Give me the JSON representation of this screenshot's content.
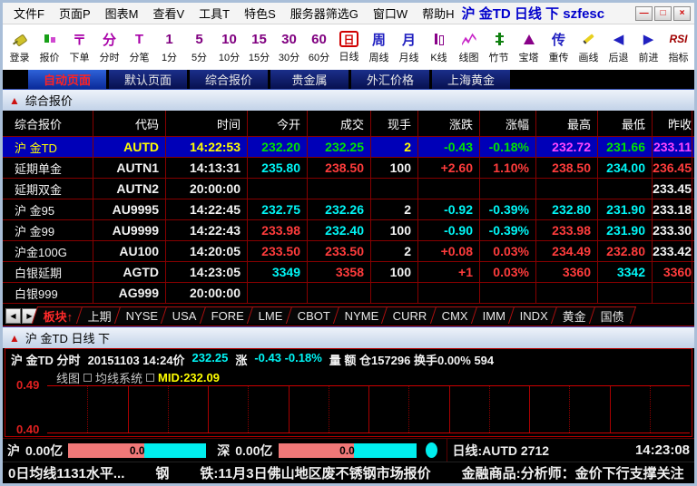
{
  "colors": {
    "up": "#ff3c3c",
    "down": "#00f6f6",
    "green": "#00e400",
    "magenta": "#ff46ff",
    "yellow": "#ffff00",
    "white": "#f2f2f2",
    "grid": "#860000",
    "sel_bg": "#0000b8",
    "title_blue": "#0000cc",
    "tab_active_red": "#ff2222",
    "bar_red": "#f07878",
    "bar_cyan": "#00eeee",
    "mid_yellow": "#ffff00"
  },
  "window": {
    "title": "沪 金TD 日线 下 szfesc",
    "controls": [
      {
        "name": "minimize-button",
        "glyph": "—"
      },
      {
        "name": "maximize-button",
        "glyph": "□"
      },
      {
        "name": "close-button",
        "glyph": "×"
      }
    ]
  },
  "menu": {
    "items": [
      {
        "name": "menu-file",
        "label": "文件F"
      },
      {
        "name": "menu-page",
        "label": "页面P"
      },
      {
        "name": "menu-chart",
        "label": "图表M"
      },
      {
        "name": "menu-view",
        "label": "查看V"
      },
      {
        "name": "menu-tools",
        "label": "工具T"
      },
      {
        "name": "menu-features",
        "label": "特色S"
      },
      {
        "name": "menu-server-filter",
        "label": "服务器筛选G"
      },
      {
        "name": "menu-window",
        "label": "窗口W"
      },
      {
        "name": "menu-help",
        "label": "帮助H"
      }
    ]
  },
  "toolbar": {
    "items": [
      {
        "name": "toolbar-login",
        "label": "登录",
        "icon": "login-plug-icon",
        "shape": "plug"
      },
      {
        "name": "toolbar-quote",
        "label": "报价",
        "icon": "quote-board-icon",
        "shape": "quote"
      },
      {
        "name": "toolbar-order",
        "label": "下单",
        "icon": "order-icon",
        "glyph": "〒",
        "color": "#a800a8"
      },
      {
        "name": "toolbar-intraday",
        "label": "分时",
        "icon": "intraday-chart-icon",
        "glyph": "分",
        "color": "#a800a8"
      },
      {
        "name": "toolbar-tick",
        "label": "分笔",
        "icon": "tick-chart-icon",
        "glyph": "T",
        "color": "#a800a8"
      },
      {
        "name": "toolbar-1min",
        "label": "1分",
        "icon": "1min-icon",
        "glyph": "1",
        "color": "#800080"
      },
      {
        "name": "toolbar-5min",
        "label": "5分",
        "icon": "5min-icon",
        "glyph": "5",
        "color": "#800080"
      },
      {
        "name": "toolbar-10min",
        "label": "10分",
        "icon": "10min-icon",
        "glyph": "10",
        "color": "#800080"
      },
      {
        "name": "toolbar-15min",
        "label": "15分",
        "icon": "15min-icon",
        "glyph": "15",
        "color": "#800080"
      },
      {
        "name": "toolbar-30min",
        "label": "30分",
        "icon": "30min-icon",
        "glyph": "30",
        "color": "#800080"
      },
      {
        "name": "toolbar-60min",
        "label": "60分",
        "icon": "60min-icon",
        "glyph": "60",
        "color": "#800080"
      },
      {
        "name": "toolbar-daily",
        "label": "日线",
        "icon": "daily-kline-icon",
        "glyph": "日",
        "color": "#d00000",
        "boxed": true
      },
      {
        "name": "toolbar-weekly",
        "label": "周线",
        "icon": "weekly-kline-icon",
        "glyph": "周",
        "color": "#2020c0"
      },
      {
        "name": "toolbar-monthly",
        "label": "月线",
        "icon": "monthly-kline-icon",
        "glyph": "月",
        "color": "#2020c0"
      },
      {
        "name": "toolbar-kline",
        "label": "K线",
        "icon": "candlestick-icon",
        "shape": "candle"
      },
      {
        "name": "toolbar-linechart",
        "label": "线图",
        "icon": "line-chart-icon",
        "shape": "zigzag"
      },
      {
        "name": "toolbar-bamboo",
        "label": "竹节",
        "icon": "bamboo-chart-icon",
        "shape": "bamboo"
      },
      {
        "name": "toolbar-pagoda",
        "label": "宝塔",
        "icon": "pagoda-chart-icon",
        "shape": "pagoda"
      },
      {
        "name": "toolbar-retransmit",
        "label": "重传",
        "icon": "retransmit-icon",
        "glyph": "传",
        "color": "#2020c0"
      },
      {
        "name": "toolbar-drawline",
        "label": "画线",
        "icon": "draw-line-pencil-icon",
        "shape": "pencil"
      },
      {
        "name": "toolbar-back",
        "label": "后退",
        "icon": "back-arrow-icon",
        "glyph": "◀",
        "color": "#2020c0"
      },
      {
        "name": "toolbar-forward",
        "label": "前进",
        "icon": "forward-arrow-icon",
        "glyph": "▶",
        "color": "#2020c0"
      },
      {
        "name": "toolbar-indicator",
        "label": "指标",
        "icon": "rsi-indicator-icon",
        "glyph": "RSI",
        "color": "#a00000",
        "rsi": true
      }
    ]
  },
  "page_tabs": {
    "active_index": 0,
    "items": [
      {
        "name": "tab-auto-page",
        "label": "自动页面"
      },
      {
        "name": "tab-default-page",
        "label": "默认页面"
      },
      {
        "name": "tab-composite-quote",
        "label": "综合报价"
      },
      {
        "name": "tab-precious-metals",
        "label": "贵金属"
      },
      {
        "name": "tab-forex-price",
        "label": "外汇价格"
      },
      {
        "name": "tab-shanghai-gold",
        "label": "上海黄金"
      }
    ]
  },
  "quote_panel": {
    "title": "综合报价",
    "headers": [
      "综合报价",
      "代码",
      "时间",
      "今开",
      "成交",
      "现手",
      "涨跌",
      "涨幅",
      "最高",
      "最低",
      "昨收"
    ],
    "column_keys": [
      "name",
      "code",
      "time",
      "open",
      "last",
      "volume",
      "change",
      "change-pct",
      "high",
      "low",
      "prev-close"
    ],
    "rows": [
      {
        "code": "AUTD",
        "selected": true,
        "values": [
          "沪 金TD",
          "AUTD",
          "14:22:53",
          "232.20",
          "232.25",
          "2",
          "-0.43",
          "-0.18%",
          "232.72",
          "231.66",
          "233.11"
        ],
        "cell_colors": [
          "yellow",
          "yellow",
          "yellow",
          "green",
          "green",
          "yellow",
          "green",
          "green",
          "magenta",
          "green",
          "magenta"
        ]
      },
      {
        "code": "AUTN1",
        "selected": false,
        "values": [
          "延期单金",
          "AUTN1",
          "14:13:31",
          "235.80",
          "238.50",
          "100",
          "+2.60",
          "1.10%",
          "238.50",
          "234.00",
          "236.45"
        ],
        "cell_colors": [
          "white",
          "white",
          "white",
          "down",
          "up",
          "white",
          "up",
          "up",
          "up",
          "down",
          "up"
        ]
      },
      {
        "code": "AUTN2",
        "selected": false,
        "values": [
          "延期双金",
          "AUTN2",
          "20:00:00",
          "",
          "",
          "",
          "",
          "",
          "",
          "",
          "233.45"
        ],
        "cell_colors": [
          "white",
          "white",
          "white",
          "white",
          "white",
          "white",
          "white",
          "white",
          "white",
          "white",
          "white"
        ]
      },
      {
        "code": "AU9995",
        "selected": false,
        "values": [
          "沪 金95",
          "AU9995",
          "14:22:45",
          "232.75",
          "232.26",
          "2",
          "-0.92",
          "-0.39%",
          "232.80",
          "231.90",
          "233.18"
        ],
        "cell_colors": [
          "white",
          "white",
          "white",
          "down",
          "down",
          "white",
          "down",
          "down",
          "down",
          "down",
          "white"
        ]
      },
      {
        "code": "AU9999",
        "selected": false,
        "values": [
          "沪 金99",
          "AU9999",
          "14:22:43",
          "233.98",
          "232.40",
          "100",
          "-0.90",
          "-0.39%",
          "233.98",
          "231.90",
          "233.30"
        ],
        "cell_colors": [
          "white",
          "white",
          "white",
          "up",
          "down",
          "white",
          "down",
          "down",
          "up",
          "down",
          "white"
        ]
      },
      {
        "code": "AU100",
        "selected": false,
        "values": [
          "沪金100G",
          "AU100",
          "14:20:05",
          "233.50",
          "233.50",
          "2",
          "+0.08",
          "0.03%",
          "234.49",
          "232.80",
          "233.42"
        ],
        "cell_colors": [
          "white",
          "white",
          "white",
          "up",
          "up",
          "white",
          "up",
          "up",
          "up",
          "up",
          "white"
        ]
      },
      {
        "code": "AGTD",
        "selected": false,
        "values": [
          "白银延期",
          "AGTD",
          "14:23:05",
          "3349",
          "3358",
          "100",
          "+1",
          "0.03%",
          "3360",
          "3342",
          "3360"
        ],
        "cell_colors": [
          "white",
          "white",
          "white",
          "down",
          "up",
          "white",
          "up",
          "up",
          "up",
          "down",
          "up"
        ]
      },
      {
        "code": "AG999",
        "selected": false,
        "values": [
          "白银999",
          "AG999",
          "20:00:00",
          "",
          "",
          "",
          "",
          "",
          "",
          "",
          ""
        ],
        "cell_colors": [
          "white",
          "white",
          "white",
          "white",
          "white",
          "white",
          "white",
          "white",
          "white",
          "white",
          "white"
        ]
      }
    ]
  },
  "market_tabs": {
    "scroll_left_glyph": "◀",
    "scroll_right_glyph": "▶",
    "items": [
      {
        "name": "market-tab-sectors",
        "label": "板块↑"
      },
      {
        "name": "market-tab-shfe",
        "label": "上期"
      },
      {
        "name": "market-tab-nyse",
        "label": "NYSE"
      },
      {
        "name": "market-tab-usa",
        "label": "USA"
      },
      {
        "name": "market-tab-fore",
        "label": "FORE"
      },
      {
        "name": "market-tab-lme",
        "label": "LME"
      },
      {
        "name": "market-tab-cbot",
        "label": "CBOT"
      },
      {
        "name": "market-tab-nyme",
        "label": "NYME"
      },
      {
        "name": "market-tab-curr",
        "label": "CURR"
      },
      {
        "name": "market-tab-cmx",
        "label": "CMX"
      },
      {
        "name": "market-tab-imm",
        "label": "IMM"
      },
      {
        "name": "market-tab-indx",
        "label": "INDX"
      },
      {
        "name": "market-tab-gold",
        "label": "黄金"
      },
      {
        "name": "market-tab-bonds",
        "label": "国债"
      }
    ]
  },
  "chart_panel": {
    "title": "沪 金TD 日线 下",
    "info_segments": [
      {
        "text": "沪 金TD 分时",
        "color": "white"
      },
      {
        "text": "20151103 14:24价",
        "color": "white"
      },
      {
        "text": "232.25",
        "color": "down"
      },
      {
        "text": "涨",
        "color": "white"
      },
      {
        "text": "-0.43 -0.18%",
        "color": "down"
      },
      {
        "text": "量 额 仓157296 换手0.00% 594",
        "color": "white"
      }
    ],
    "legend": {
      "series_label": "线图",
      "ma_label": "均线系统",
      "mid_label": "MID:232.09"
    },
    "y_labels": [
      "0.49",
      "0.40"
    ]
  },
  "status_bar": {
    "sh_label": "沪",
    "sh_value": "0.00亿",
    "sh_bar_value": "0.0",
    "sz_label": "深",
    "sz_value": "0.00亿",
    "sz_bar_value": "0.0",
    "session_label": "日线:AUTD 2712",
    "time": "14:23:08"
  },
  "ticker": {
    "segments": [
      "0日均线1131水平...",
      "钢",
      "铁:11月3日佛山地区废不锈钢市场报价",
      "金融商品:分析师：金价下行支撑关注"
    ]
  }
}
